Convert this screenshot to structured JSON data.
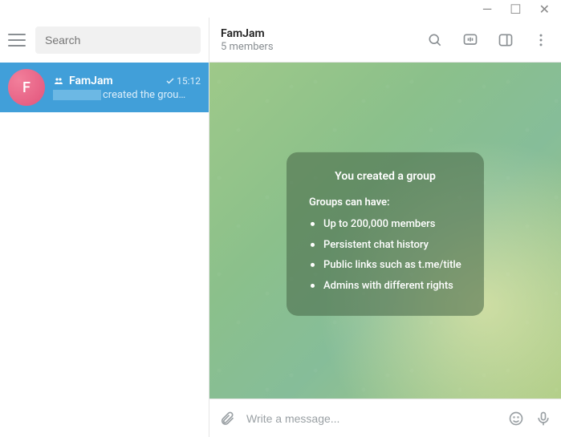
{
  "window": {
    "minimize": "—",
    "maximize": "☐",
    "close": "✕"
  },
  "sidebar": {
    "search_placeholder": "Search",
    "chat": {
      "avatar_letter": "F",
      "name": "FamJam",
      "time": "15:12",
      "preview": "created the grou…"
    }
  },
  "header": {
    "title": "FamJam",
    "subtitle": "5 members"
  },
  "infobox": {
    "headline": "You created a group",
    "subhead": "Groups can have:",
    "items": [
      "Up to 200,000 members",
      "Persistent chat history",
      "Public links such as t.me/title",
      "Admins with different rights"
    ]
  },
  "composer": {
    "placeholder": "Write a message..."
  }
}
